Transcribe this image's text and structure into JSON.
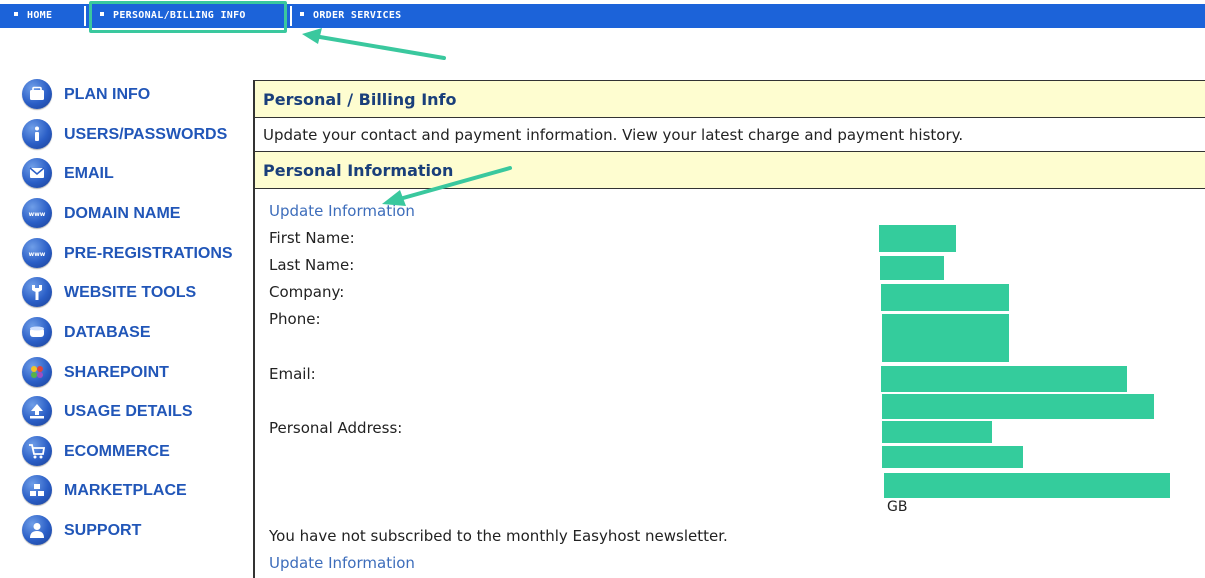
{
  "topnav": {
    "home": "HOME",
    "billing": "PERSONAL/BILLING INFO",
    "order": "ORDER SERVICES"
  },
  "sidebar": {
    "items": [
      {
        "label": "PLAN INFO",
        "icon": "folder-icon"
      },
      {
        "label": "USERS/PASSWORDS",
        "icon": "info-icon"
      },
      {
        "label": "EMAIL",
        "icon": "envelope-icon"
      },
      {
        "label": "DOMAIN NAME",
        "icon": "www-icon"
      },
      {
        "label": "PRE-REGISTRATIONS",
        "icon": "www-icon"
      },
      {
        "label": "WEBSITE TOOLS",
        "icon": "wrench-icon"
      },
      {
        "label": "DATABASE",
        "icon": "database-icon"
      },
      {
        "label": "SHAREPOINT",
        "icon": "sharepoint-icon"
      },
      {
        "label": "USAGE DETAILS",
        "icon": "upload-icon"
      },
      {
        "label": "ECOMMERCE",
        "icon": "cart-icon"
      },
      {
        "label": "MARKETPLACE",
        "icon": "blocks-icon"
      },
      {
        "label": "SUPPORT",
        "icon": "person-icon"
      }
    ]
  },
  "main": {
    "title": "Personal / Billing Info",
    "description": "Update your contact and payment information. View your latest charge and payment history.",
    "section_title": "Personal Information",
    "update_link": "Update Information",
    "fields": {
      "first_name": "First Name:",
      "last_name": "Last Name:",
      "company": "Company:",
      "phone": "Phone:",
      "email": "Email:",
      "address": "Personal Address:"
    },
    "country": "GB",
    "newsletter_text": "You have not subscribed to the monthly Easyhost newsletter.",
    "update_link_2": "Update Information"
  },
  "colors": {
    "nav": "#1c63d9",
    "sidebar_text": "#2156b8",
    "header_bg": "#fefdd0",
    "header_text": "#1a3f7a",
    "link": "#3d6dbb",
    "annotation": "#3ac89e"
  }
}
